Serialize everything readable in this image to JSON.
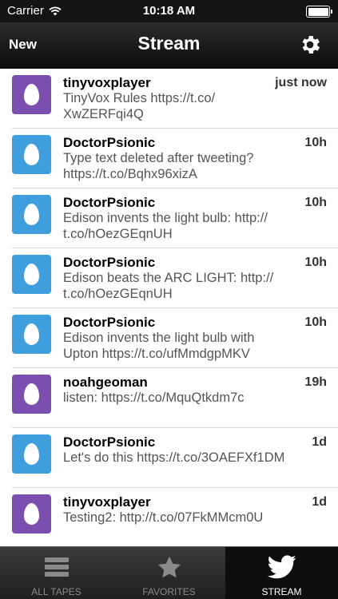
{
  "status": {
    "carrier": "Carrier",
    "time": "10:18 AM"
  },
  "nav": {
    "left_button": "New",
    "title": "Stream",
    "settings_icon": "gear-icon"
  },
  "tweets": [
    {
      "name": "tinyvoxplayer",
      "time": "just now",
      "text": "TinyVox Rules https://t.co/\nXwZERFqi4Q",
      "avatar_color": "#7b4fb0"
    },
    {
      "name": "DoctorPsionic",
      "time": "10h",
      "text": "Type text deleted after tweeting?\nhttps://t.co/Bqhx96xizA",
      "avatar_color": "#3f9fde"
    },
    {
      "name": "DoctorPsionic",
      "time": "10h",
      "text": "Edison invents the light bulb: http://\nt.co/hOezGEqnUH",
      "avatar_color": "#3f9fde"
    },
    {
      "name": "DoctorPsionic",
      "time": "10h",
      "text": "Edison beats the ARC LIGHT: http://\nt.co/hOezGEqnUH",
      "avatar_color": "#3f9fde"
    },
    {
      "name": "DoctorPsionic",
      "time": "10h",
      "text": "Edison invents the light bulb with\nUpton https://t.co/ufMmdgpMKV",
      "avatar_color": "#3f9fde"
    },
    {
      "name": "noahgeoman",
      "time": "19h",
      "text": "listen: https://t.co/MquQtkdm7c",
      "avatar_color": "#7b4fb0"
    },
    {
      "name": "DoctorPsionic",
      "time": "1d",
      "text": "Let's do this https://t.co/3OAEFXf1DM",
      "avatar_color": "#3f9fde"
    },
    {
      "name": "tinyvoxplayer",
      "time": "1d",
      "text": "Testing2: http://t.co/07FkMMcm0U",
      "avatar_color": "#7b4fb0"
    }
  ],
  "tabs": [
    {
      "label": "ALL TAPES",
      "icon": "list-icon",
      "active": false
    },
    {
      "label": "FAVORITES",
      "icon": "star-icon",
      "active": false
    },
    {
      "label": "STREAM",
      "icon": "twitter-bird-icon",
      "active": true
    }
  ]
}
